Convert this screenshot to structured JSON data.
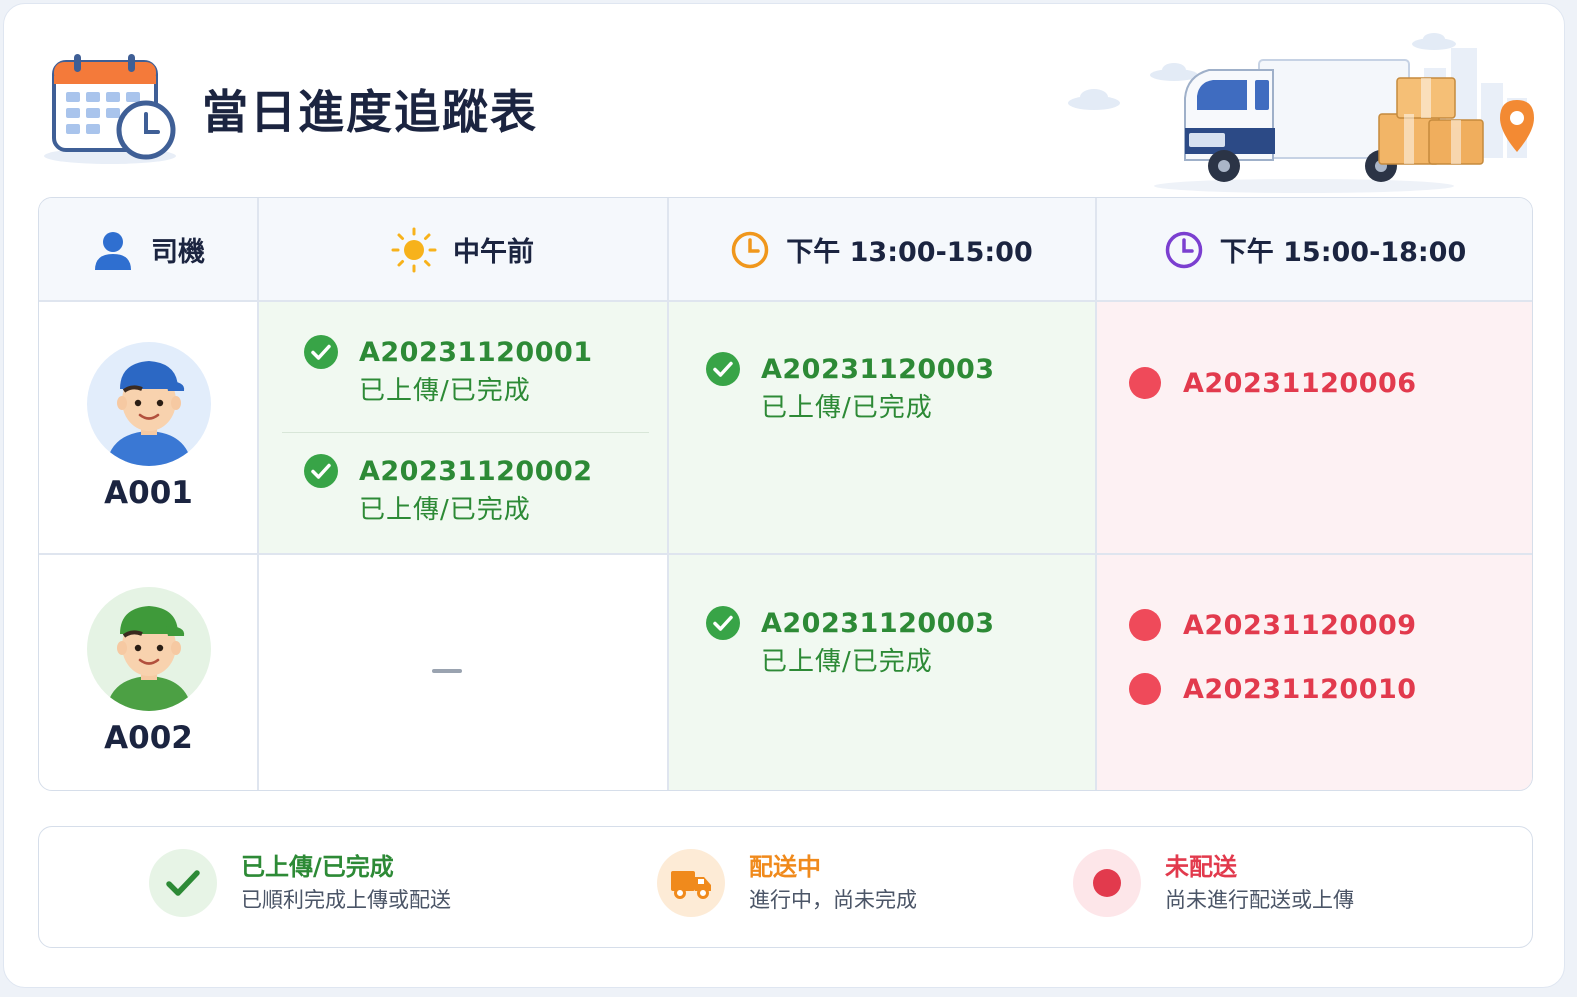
{
  "header": {
    "title": "當日進度追蹤表"
  },
  "columns": {
    "driver": "司機",
    "before_noon": "中午前",
    "pm1": "下午 13:00-15:00",
    "pm2": "下午 15:00-18:00"
  },
  "rows": [
    {
      "driver": "A001",
      "before_noon": [
        {
          "code": "A20231120001",
          "status": "已上傳/已完成"
        },
        {
          "code": "A20231120002",
          "status": "已上傳/已完成"
        }
      ],
      "pm1": [
        {
          "code": "A20231120003",
          "status": "已上傳/已完成"
        }
      ],
      "pm2": [
        {
          "code": "A20231120006"
        }
      ]
    },
    {
      "driver": "A002",
      "before_noon_empty": "—",
      "pm1": [
        {
          "code": "A20231120003",
          "status": "已上傳/已完成"
        }
      ],
      "pm2": [
        {
          "code": "A20231120009"
        },
        {
          "code": "A20231120010"
        }
      ]
    }
  ],
  "legend": [
    {
      "title": "已上傳/已完成",
      "desc": "已順利完成上傳或配送",
      "color": "#2d8a36",
      "icon": "check-icon"
    },
    {
      "title": "配送中",
      "desc": "進行中，尚未完成",
      "color": "#f08a1c",
      "icon": "truck-icon"
    },
    {
      "title": "未配送",
      "desc": "尚未進行配送或上傳",
      "color": "#e23a4d",
      "icon": "red-dot-icon"
    }
  ],
  "colors": {
    "done": "#2d8a36",
    "in_progress": "#f08a1c",
    "not_sent": "#e23a4d"
  }
}
